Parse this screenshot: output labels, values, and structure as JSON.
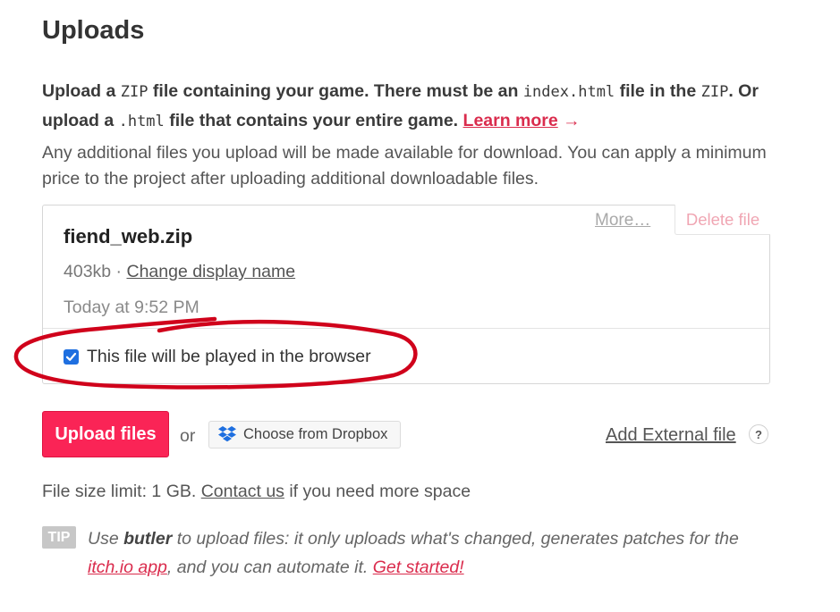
{
  "header": {
    "title": "Uploads"
  },
  "intro": {
    "part1": "Upload a ",
    "code1": "ZIP",
    "part2": " file containing your game. There must be an ",
    "code2": "index.html",
    "part3": " file in the ",
    "code3": "ZIP",
    "part4": ". Or upload a ",
    "code4": ".html",
    "part5": " file that contains your entire game. ",
    "learn_more": "Learn more",
    "arrow": "→"
  },
  "extra_text": "Any additional files you upload will be made available for download. You can apply a minimum price to the project after uploading additional downloadable files.",
  "file": {
    "name": "fiend_web.zip",
    "more_label": "More…",
    "delete_label": "Delete file",
    "size": "403kb",
    "separator": " · ",
    "change_name_label": "Change display name",
    "date": "Today at 9:52 PM",
    "browser_checkbox_checked": true,
    "browser_label": "This file will be played in the browser"
  },
  "actions": {
    "upload_label": "Upload files",
    "or_label": "or",
    "dropbox_label": "Choose from Dropbox",
    "external_label": "Add External file",
    "help_label": "?"
  },
  "limit": {
    "prefix": "File size limit: 1 GB. ",
    "contact_label": "Contact us",
    "suffix": " if you need more space"
  },
  "tip": {
    "badge": "TIP",
    "use": "Use ",
    "butler": "butler",
    "middle": " to upload files: it only uploads what's changed, generates patches for the ",
    "app_link": "itch.io app",
    "after": ", and you can automate it. ",
    "started_link": "Get started!"
  },
  "colors": {
    "accent": "#fa2456",
    "link_red": "#da2c4d",
    "checkbox_blue": "#1e6fe0",
    "annotation_red": "#d0021b"
  }
}
